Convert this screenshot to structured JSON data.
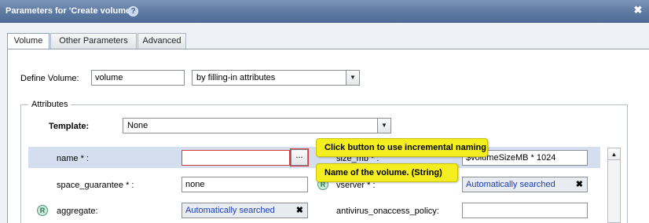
{
  "window": {
    "title": "Parameters for 'Create volume'",
    "help_icon": "help-icon",
    "close_icon": "close-icon",
    "close_glyph": "✖",
    "help_glyph": "?"
  },
  "tabs": [
    {
      "label": "Volume",
      "active": true
    },
    {
      "label": "Other Parameters",
      "active": false
    },
    {
      "label": "Advanced",
      "active": false
    }
  ],
  "define_volume": {
    "label": "Define Volume:",
    "value": "volume",
    "mode_selected": "by filling-in attributes"
  },
  "attributes": {
    "legend": "Attributes",
    "template_label": "Template:",
    "template_selected": "None",
    "fields": {
      "name": {
        "label": "name * :",
        "value": "",
        "browse_label": "..."
      },
      "size_mb": {
        "label": "size_mb * :",
        "value": "$volumeSizeMB * 1024"
      },
      "space_guarantee": {
        "label": "space_guarantee * :",
        "value": "none"
      },
      "vserver": {
        "label": "vserver * :",
        "value": "Automatically searched"
      },
      "aggregate": {
        "label": "aggregate:",
        "value": "Automatically searched"
      },
      "antivirus_onaccess_policy": {
        "label": "antivirus_onaccess_policy:",
        "value": ""
      }
    },
    "r_badge": "R",
    "clear_glyph": "✖"
  },
  "tooltips": {
    "browse": "Click button to use incremental naming",
    "name": "Name of the volume. (String)"
  },
  "dropdown_arrow": "▼",
  "scroll_up_arrow": "▲",
  "colors": {
    "titlebar": "#5d7aa3",
    "highlight_row": "#d5deee",
    "tooltip": "#f3ee1f",
    "error_border": "#d43b3b",
    "auto_text": "#1a3fb4"
  }
}
